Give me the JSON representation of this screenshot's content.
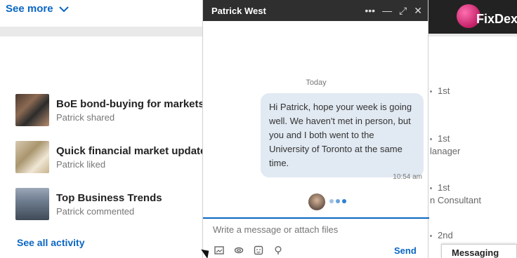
{
  "left": {
    "see_more": "See more",
    "activity": [
      {
        "title": "BoE bond-buying for markets",
        "sub": "Patrick shared"
      },
      {
        "title": "Quick financial market update",
        "sub": "Patrick liked"
      },
      {
        "title": "Top Business Trends",
        "sub": "Patrick commented"
      }
    ],
    "see_all": "See all activity"
  },
  "right": {
    "brand": "FixDex",
    "connections": [
      {
        "degree": "1st",
        "title": ""
      },
      {
        "degree": "1st",
        "title": "lanager"
      },
      {
        "degree": "1st",
        "title": "n Consultant"
      },
      {
        "degree": "2nd",
        "title": ""
      }
    ]
  },
  "chat": {
    "name": "Patrick West",
    "date_label": "Today",
    "message": "Hi Patrick, hope your week is going well. We haven't met in person, but you and I both went to the University of Toronto at the same time.",
    "time": "10:54 am",
    "placeholder": "Write a message or attach files",
    "send_label": "Send",
    "icons": {
      "more": "more-icon",
      "minimize": "minimize-icon",
      "expand": "expand-icon",
      "close": "close-icon"
    }
  },
  "messaging_tab": "Messaging",
  "colors": {
    "accent": "#0a66c2",
    "bubble": "#e1e9f2",
    "header": "#2f2f2f"
  }
}
